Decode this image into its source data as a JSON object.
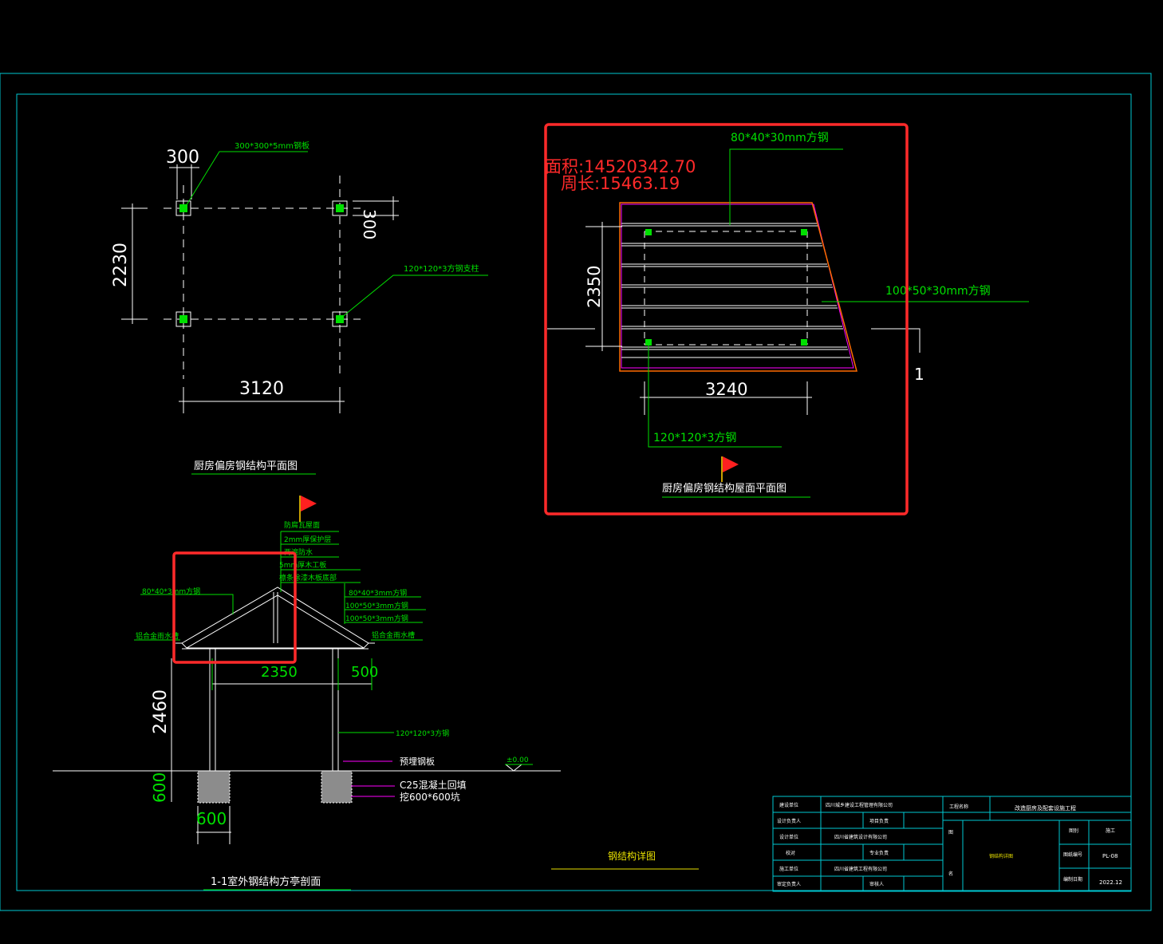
{
  "colors": {
    "background": "#000000",
    "frame": "#00c8d2",
    "line": "#ffffff",
    "dim": "#ffffff",
    "annotation": "#00e000",
    "magenta": "#ff00ff",
    "highlight": "#ff2a2a",
    "yellow": "#e8e000",
    "orange": "#ff6a00"
  },
  "plan": {
    "title": "厨房偏房钢结构平面图",
    "dim_top": "300",
    "dim_side_small": "300",
    "dim_left": "2230",
    "dim_bottom": "3120",
    "note_plate": "300*300*5mm钢板",
    "note_column": "120*120*3方钢支柱"
  },
  "roof_plan": {
    "title": "厨房偏房钢结构屋面平面图",
    "area_label": "面积:14520342.70",
    "perimeter_label": "周长:15463.19",
    "note_top": "80*40*30mm方钢",
    "note_right": "100*50*30mm方钢",
    "note_column": "120*120*3方钢",
    "dim_left": "2350",
    "dim_bottom": "3240",
    "section_mark": "1"
  },
  "section": {
    "title": "1-1室外钢结构方亭剖面",
    "layers": [
      "防腐瓦屋面",
      "2mm厚保护层",
      "两遍防水",
      "5mm厚木工板",
      "檩条涂漆木板底部"
    ],
    "note_left_beam": "80*40*3mm方钢",
    "note_left_gutter": "铝合金雨水槽",
    "note_right_1": "80*40*3mm方钢",
    "note_right_2": "100*50*3mm方钢",
    "note_right_3": "100*50*3mm方钢",
    "note_right_gutter": "铝合金雨水槽",
    "note_column": "120*120*3方钢",
    "note_plate": "预埋钢板",
    "note_concrete": "C25混凝土回填",
    "note_pit": "挖600*600坑",
    "level": "±0.00",
    "dim_span": "2350",
    "dim_overhang": "500",
    "dim_height": "2460",
    "dim_depth": "600",
    "dim_width": "600"
  },
  "center_title": "钢结构详图",
  "title_block": {
    "r1_label": "建设单位",
    "r1_value": "四川城乡建设工程管理有限公司",
    "r2_label": "设计负责人",
    "r2_value": "项目负责",
    "r3_label": "设计单位",
    "r3_value": "四川省建筑设计有限公司",
    "r4_label": "校对",
    "r4_value": "专业负责",
    "r5_label": "施工单位",
    "r5_value": "四川省建筑工程有限公司",
    "r6_label": "审定负责人",
    "r6_value": "审核人",
    "project_label": "工程名称",
    "project_value": "改造厨房及配套设施工程",
    "drawing_label": "图",
    "drawing_label2": "名",
    "drawing_value": "钢结构详图",
    "cat_label": "图别",
    "cat_value": "施工",
    "num_label": "图纸编号",
    "num_value": "PL-08",
    "date_label": "编制日期",
    "date_value": "2022.12"
  }
}
